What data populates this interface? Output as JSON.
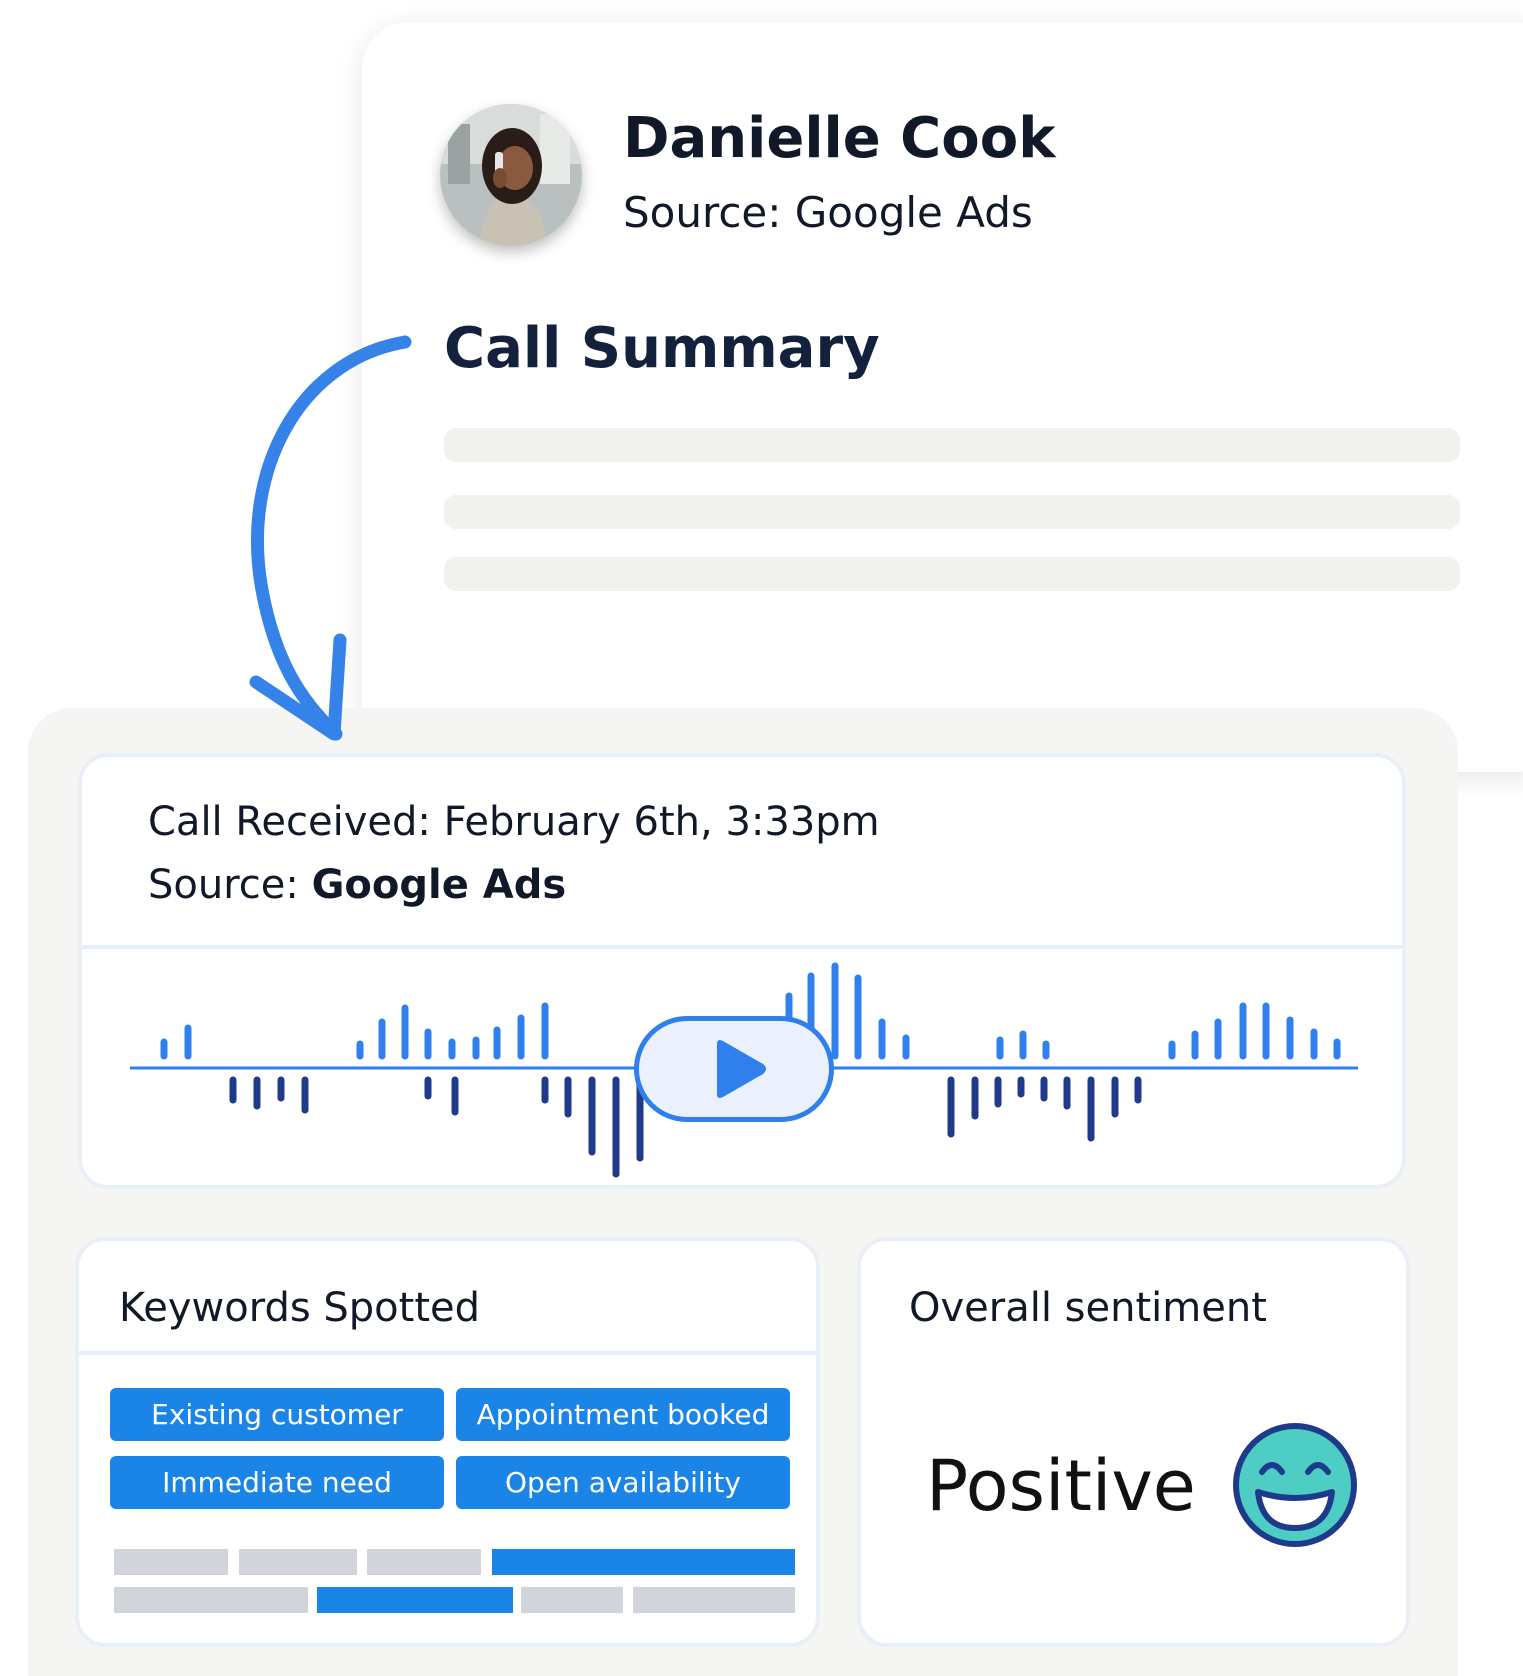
{
  "contact": {
    "name": "Danielle Cook",
    "source_line": "Source: Google Ads",
    "avatar": "person-on-phone-photo"
  },
  "summary": {
    "title": "Call Summary"
  },
  "call": {
    "received_prefix": "Call Received: ",
    "received_value": "February 6th, 3:33pm",
    "source_prefix": "Source: ",
    "source_value": "Google Ads"
  },
  "player": {
    "icon": "play-icon"
  },
  "keywords": {
    "title": "Keywords Spotted",
    "chips": [
      "Existing customer",
      "Appointment booked",
      "Immediate need",
      "Open availability"
    ]
  },
  "sentiment": {
    "title": "Overall sentiment",
    "value": "Positive",
    "icon": "grinning-face-icon"
  },
  "colors": {
    "accent_blue": "#1a85e6",
    "wave_blue": "#2f80ed",
    "wave_navy": "#1f3a8a",
    "arrow_blue": "#3583e8",
    "emoji_face": "#4ecdc4",
    "emoji_outline": "#1e3a8a"
  }
}
